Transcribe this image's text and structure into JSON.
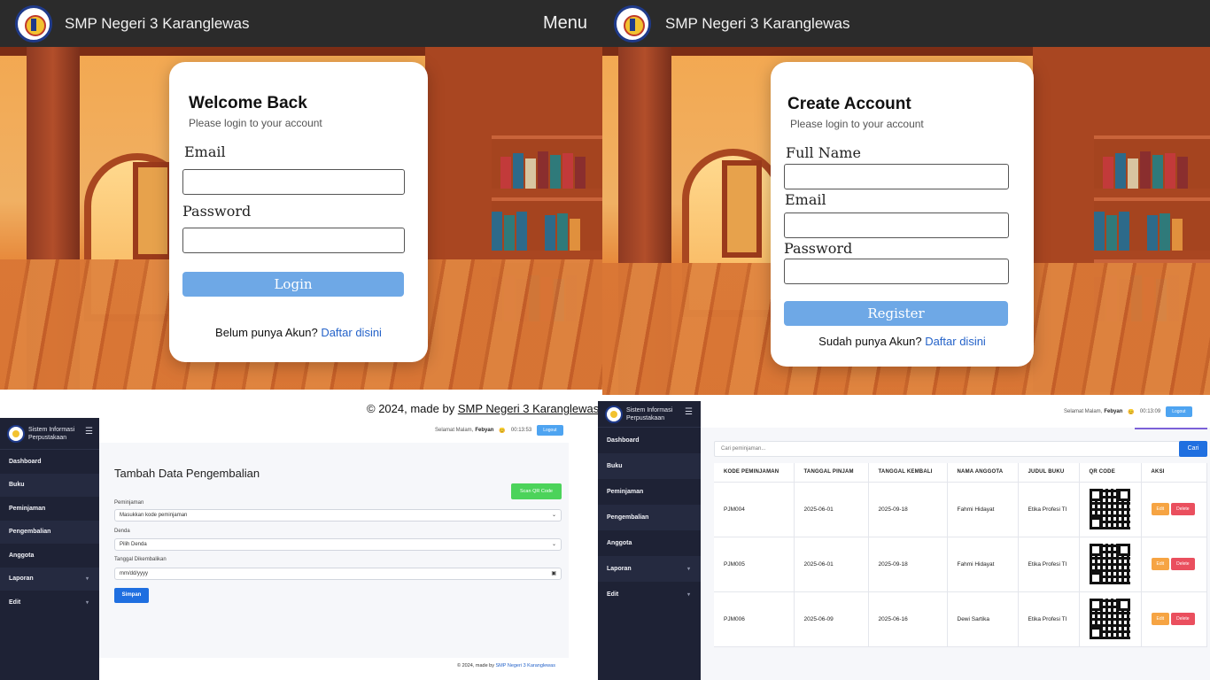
{
  "login_page": {
    "brand": "SMP Negeri 3 Karanglewas",
    "menu": "Menu",
    "title": "Welcome Back",
    "subtitle": "Please login to your account",
    "email_label": "Email",
    "password_label": "Password",
    "button": "Login",
    "footer_text": "Belum punya Akun?",
    "footer_link": "Daftar disini",
    "caption_prefix": "© 2024, made by",
    "caption_link": "SMP Negeri 3 Karanglewas"
  },
  "register_page": {
    "brand": "SMP Negeri 3 Karanglewas",
    "title": "Create Account",
    "subtitle": "Please login to your account",
    "fullname_label": "Full Name",
    "email_label": "Email",
    "password_label": "Password",
    "button": "Register",
    "footer_text": "Sudah punya Akun?",
    "footer_link": "Daftar disini"
  },
  "sidebar": {
    "title_line1": "Sistem Informasi",
    "title_line2": "Perpustakaan",
    "items": [
      "Dashboard",
      "Buku",
      "Peminjaman",
      "Pengembalian",
      "Anggota",
      "Laporan",
      "Edit"
    ]
  },
  "return_form": {
    "greeting": "Selamat Malam,",
    "user": "Febyan",
    "emoji": "😊",
    "time": "00:13:53",
    "logout": "Logout",
    "title": "Tambah Data Pengembalian",
    "scan_button": "Scan QR Code",
    "peminjaman_label": "Peminjaman",
    "peminjaman_value": "Masukkan kode peminjaman",
    "denda_label": "Denda",
    "denda_value": "Pilih Denda",
    "tanggal_label": "Tanggal Dikembalikan",
    "tanggal_value": "mm/dd/yyyy",
    "save_button": "Simpan",
    "footer_prefix": "© 2024, made by",
    "footer_link": "SMP Negeri 3 Karanglewas"
  },
  "loan_list": {
    "greeting": "Selamat Malam,",
    "user": "Febyan",
    "emoji": "😊",
    "time": "00:13:09",
    "logout": "Logout",
    "search_placeholder": "Cari peminjaman...",
    "search_button": "Cari",
    "columns": [
      "KODE PEMINJAMAN",
      "TANGGAL PINJAM",
      "TANGGAL KEMBALI",
      "NAMA ANGGOTA",
      "JUDUL BUKU",
      "QR CODE",
      "AKSI"
    ],
    "rows": [
      {
        "kode": "PJM004",
        "pinjam": "2025-06-01",
        "kembali": "2025-09-18",
        "nama": "Fahmi Hidayat",
        "judul": "Etika Profesi TI"
      },
      {
        "kode": "PJM005",
        "pinjam": "2025-06-01",
        "kembali": "2025-09-18",
        "nama": "Fahmi Hidayat",
        "judul": "Etika Profesi TI"
      },
      {
        "kode": "PJM006",
        "pinjam": "2025-06-09",
        "kembali": "2025-06-16",
        "nama": "Dewi Sartika",
        "judul": "Etika Profesi TI"
      }
    ],
    "edit_label": "Edit",
    "delete_label": "Delete"
  },
  "colors": {
    "topbar": "#2b2b2b",
    "sidebar": "#1e2235",
    "primary_button": "#6ea8e6",
    "accent_blue": "#1f6fe0",
    "scan_green": "#4cd35a",
    "edit_orange": "#f6a443",
    "delete_red": "#ea4f5e"
  }
}
